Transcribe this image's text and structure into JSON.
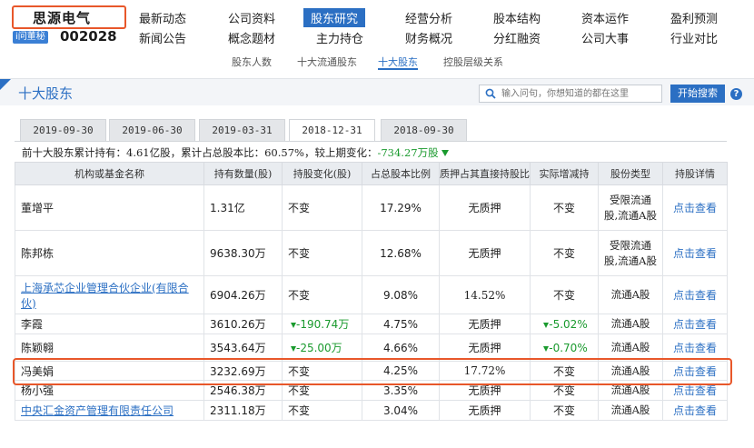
{
  "header": {
    "company_name": "思源电气",
    "ask_badge": "i问董秘",
    "stock_code": "002028"
  },
  "nav": {
    "row1": [
      "最新动态",
      "公司资料",
      "股东研究",
      "经营分析",
      "股本结构",
      "资本运作",
      "盈利预测"
    ],
    "row2": [
      "新闻公告",
      "概念题材",
      "主力持仓",
      "财务概况",
      "分红融资",
      "公司大事",
      "行业对比"
    ],
    "active": "股东研究"
  },
  "subnav": [
    "股东人数",
    "十大流通股东",
    "十大股东",
    "控股层级关系"
  ],
  "subnav_active": "十大股东",
  "section": {
    "title": "十大股东",
    "search_placeholder": "输入问句，你想知道的都在这里",
    "search_button": "开始搜索",
    "help": "?"
  },
  "date_tabs": [
    "2019-09-30",
    "2019-06-30",
    "2019-03-31",
    "2018-12-31",
    "2018-09-30"
  ],
  "date_tab_active": "2018-12-31",
  "summary": {
    "prefix": "前十大股东累计持有：",
    "shares": "4.61亿股",
    "mid": "，累计占总股本比：",
    "ratio": "60.57%",
    "mid2": "，较上期变化：",
    "change": "-734.27万股"
  },
  "table": {
    "headers": [
      "机构或基金名称",
      "持有数量(股)",
      "持股变化(股)",
      "占总股本比例",
      "质押占其直接持股比",
      "实际增减持",
      "股份类型",
      "持股详情"
    ],
    "rows": [
      {
        "name": "董增平",
        "link": false,
        "qty": "1.31亿",
        "change": "不变",
        "change_down": false,
        "ratio": "17.29%",
        "pledge": "无质押",
        "actual": "不变",
        "actual_down": false,
        "type": "受限流通股,流通A股",
        "detail": "点击查看"
      },
      {
        "name": "陈邦栋",
        "link": false,
        "qty": "9638.30万",
        "change": "不变",
        "change_down": false,
        "ratio": "12.68%",
        "pledge": "无质押",
        "actual": "不变",
        "actual_down": false,
        "type": "受限流通股,流通A股",
        "detail": "点击查看"
      },
      {
        "name": "上海承芯企业管理合伙企业(有限合伙)",
        "link": true,
        "qty": "6904.26万",
        "change": "不变",
        "change_down": false,
        "ratio": "9.08%",
        "pledge": "14.52%",
        "actual": "不变",
        "actual_down": false,
        "type": "流通A股",
        "detail": "点击查看"
      },
      {
        "name": "李霞",
        "link": false,
        "qty": "3610.26万",
        "change": "-190.74万",
        "change_down": true,
        "ratio": "4.75%",
        "pledge": "无质押",
        "actual": "-5.02%",
        "actual_down": true,
        "type": "流通A股",
        "detail": "点击查看"
      },
      {
        "name": "陈颖翱",
        "link": false,
        "qty": "3543.64万",
        "change": "-25.00万",
        "change_down": true,
        "ratio": "4.66%",
        "pledge": "无质押",
        "actual": "-0.70%",
        "actual_down": true,
        "type": "流通A股",
        "detail": "点击查看"
      },
      {
        "name": "冯美娟",
        "link": false,
        "qty": "3232.69万",
        "change": "不变",
        "change_down": false,
        "ratio": "4.25%",
        "pledge": "17.72%",
        "actual": "不变",
        "actual_down": false,
        "type": "流通A股",
        "detail": "点击查看"
      },
      {
        "name": "杨小强",
        "link": false,
        "qty": "2546.38万",
        "change": "不变",
        "change_down": false,
        "ratio": "3.35%",
        "pledge": "无质押",
        "actual": "不变",
        "actual_down": false,
        "type": "流通A股",
        "detail": "点击查看"
      },
      {
        "name": "中央汇金资产管理有限责任公司",
        "link": true,
        "qty": "2311.18万",
        "change": "不变",
        "change_down": false,
        "ratio": "3.04%",
        "pledge": "无质押",
        "actual": "不变",
        "actual_down": false,
        "type": "流通A股",
        "detail": "点击查看"
      }
    ]
  },
  "colors": {
    "accent": "#2b6fc3",
    "highlight": "#e8572a",
    "down": "#1a9a2e"
  }
}
